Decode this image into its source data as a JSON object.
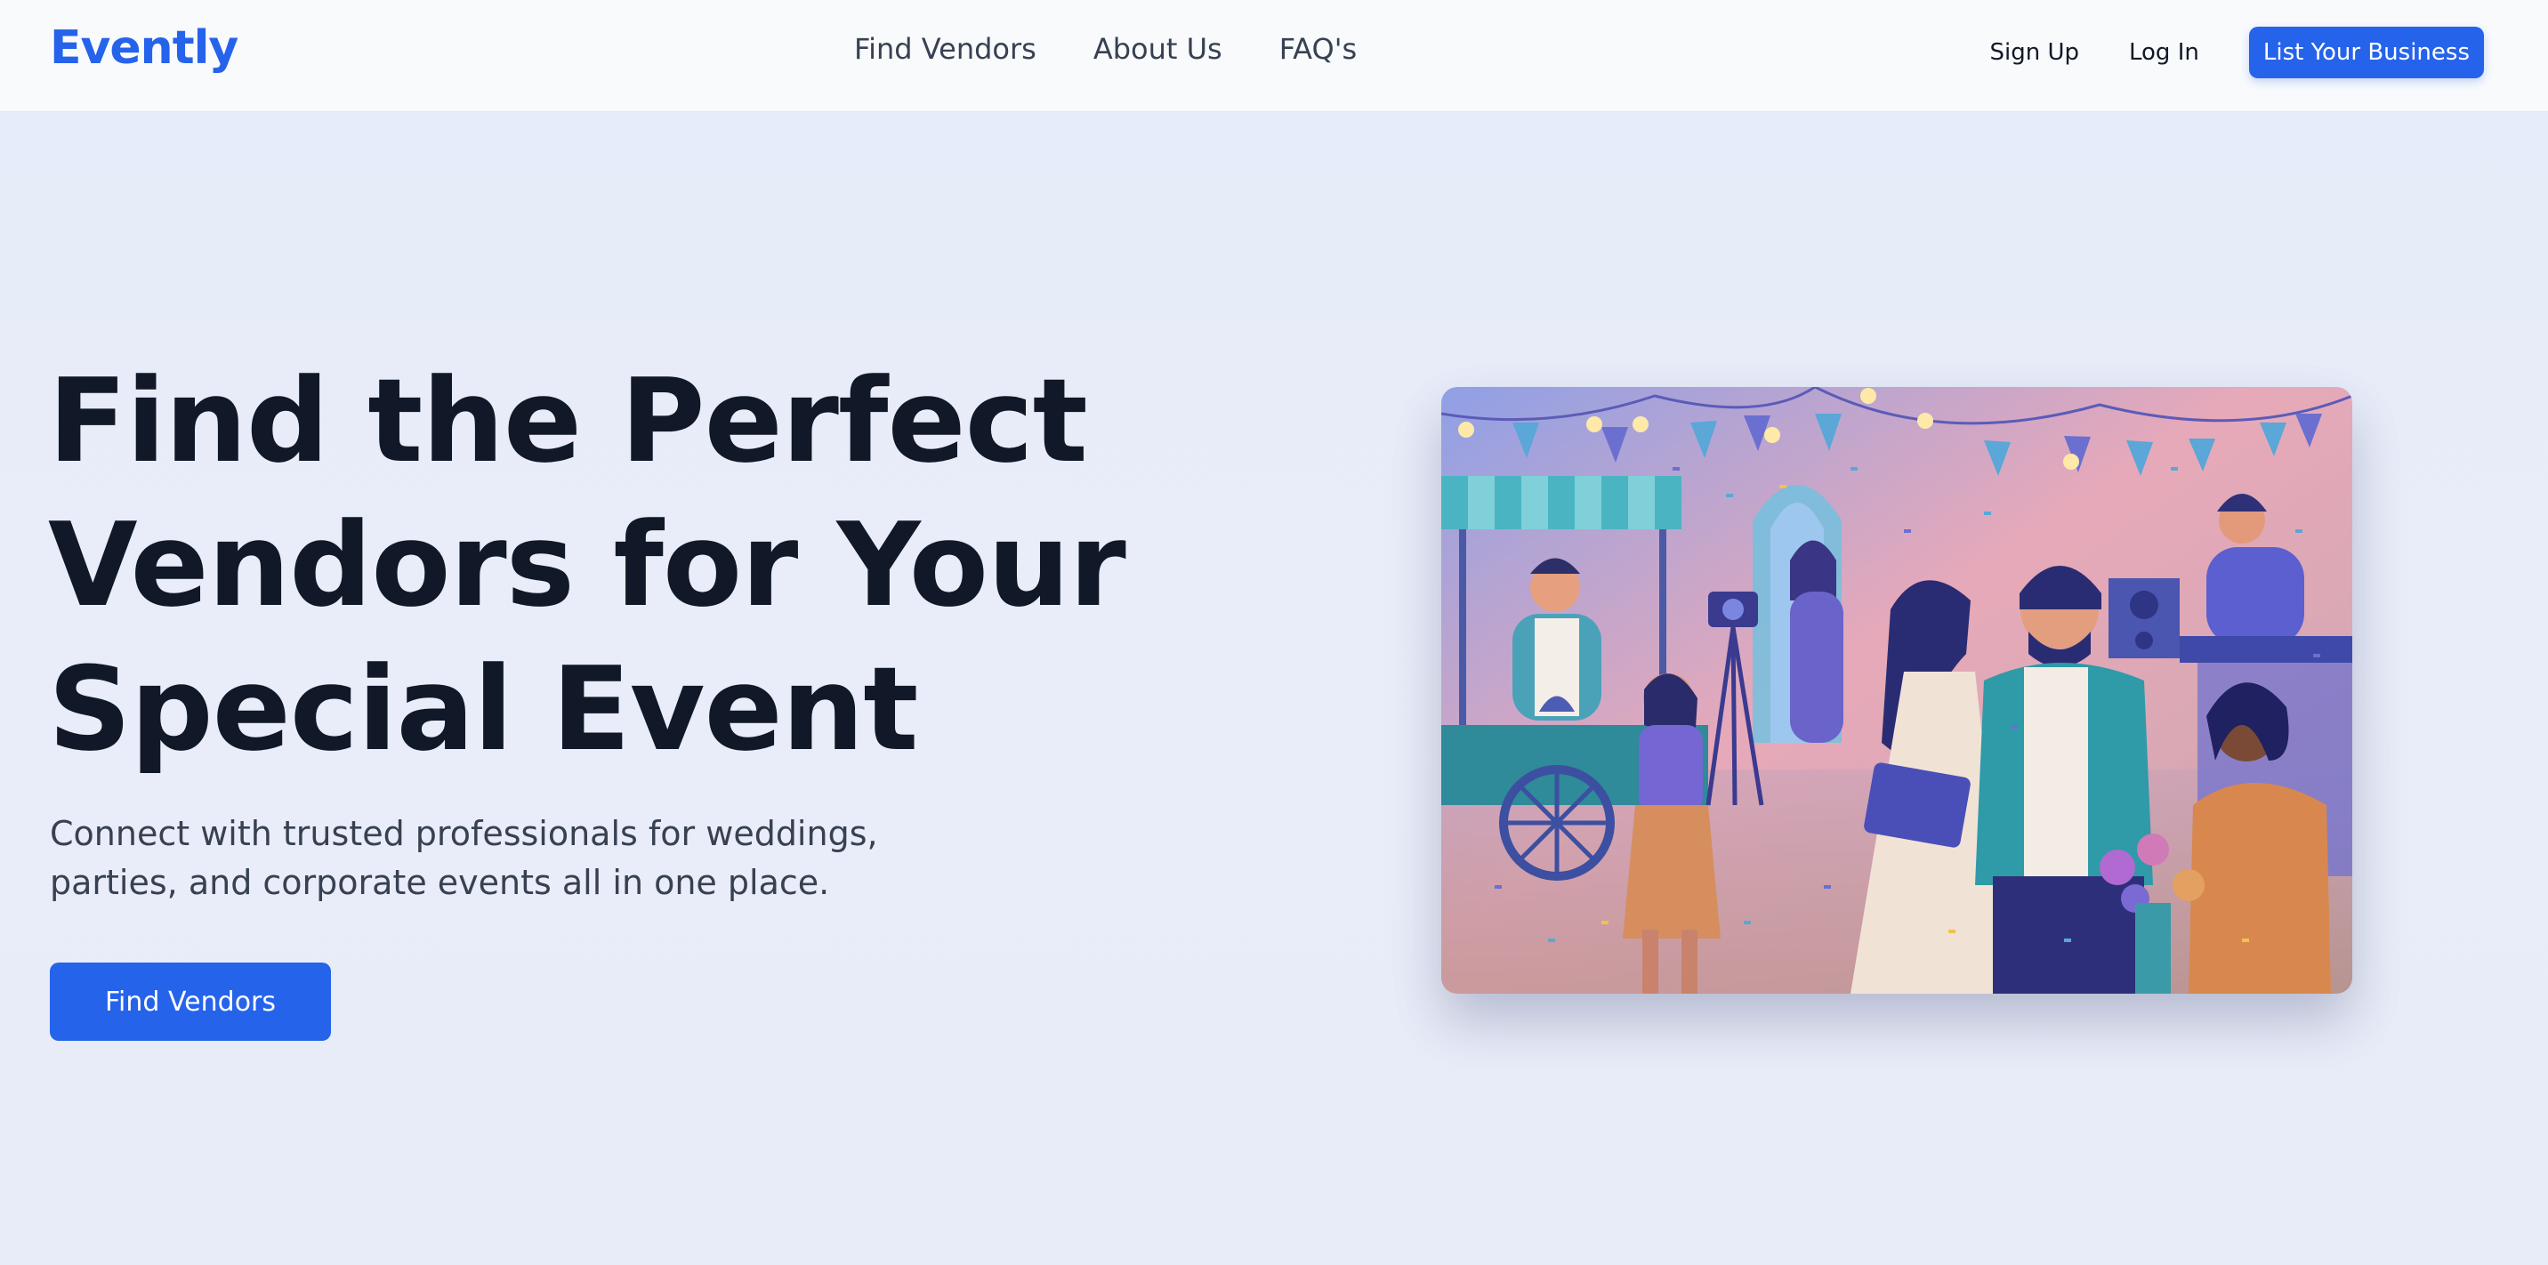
{
  "header": {
    "logo": "Evently",
    "nav": [
      "Find Vendors",
      "About Us",
      "FAQ's"
    ],
    "sign_up": "Sign Up",
    "log_in": "Log In",
    "list_business": "List Your Business"
  },
  "hero": {
    "title_lines": [
      "Find the Perfect",
      "Vendors for Your",
      "Special Event"
    ],
    "subtitle_lines": [
      "Connect with trusted professionals for weddings,",
      "parties, and corporate events all in one place."
    ],
    "cta_label": "Find Vendors"
  },
  "colors": {
    "brand": "#2563eb",
    "heading": "#111827",
    "background": "#e7ecf9"
  },
  "illustration": {
    "icon": "event-vendors-illustration"
  }
}
